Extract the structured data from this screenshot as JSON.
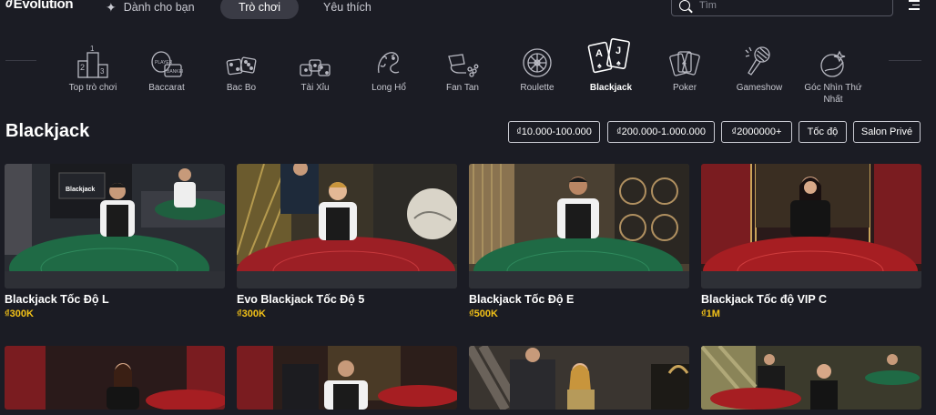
{
  "header": {
    "logo": "Evolution",
    "tabs": [
      {
        "label": "Dành cho bạn",
        "active": false
      },
      {
        "label": "Trò chơi",
        "active": true
      },
      {
        "label": "Yêu thích",
        "active": false
      }
    ],
    "search_placeholder": "Tìm"
  },
  "categories": [
    {
      "label": "Top trò chơi",
      "icon": "podium-icon"
    },
    {
      "label": "Baccarat",
      "icon": "baccarat-cards-icon"
    },
    {
      "label": "Bac Bo",
      "icon": "dice-pair-icon"
    },
    {
      "label": "Tài Xỉu",
      "icon": "dice-triple-icon"
    },
    {
      "label": "Long Hổ",
      "icon": "dragon-tiger-icon"
    },
    {
      "label": "Fan Tan",
      "icon": "fan-tan-icon"
    },
    {
      "label": "Roulette",
      "icon": "roulette-wheel-icon"
    },
    {
      "label": "Blackjack",
      "icon": "blackjack-cards-icon",
      "active": true
    },
    {
      "label": "Poker",
      "icon": "poker-cards-icon"
    },
    {
      "label": "Gameshow",
      "icon": "microphone-icon"
    },
    {
      "label": "Góc Nhìn Thứ Nhất",
      "icon": "first-person-icon"
    }
  ],
  "page_title": "Blackjack",
  "filters": [
    "₫10.000-100.000",
    "₫200.000-1.000.000",
    "₫2000000+",
    "Tốc độ",
    "Salon Privé"
  ],
  "games": [
    {
      "title": "Blackjack Tốc Độ L",
      "bet": "₫300K",
      "table": "green",
      "backdrop": "dark"
    },
    {
      "title": "Evo Blackjack Tốc Độ 5",
      "bet": "₫300K",
      "table": "red",
      "backdrop": "gold"
    },
    {
      "title": "Blackjack Tốc Độ E",
      "bet": "₫500K",
      "table": "green",
      "backdrop": "gold"
    },
    {
      "title": "Blackjack Tốc độ VIP C",
      "bet": "₫1M",
      "table": "red",
      "backdrop": "red"
    }
  ],
  "colors": {
    "background": "#1b1c24",
    "accent_bet": "#f2c118",
    "active_tab": "#3a3b45"
  }
}
